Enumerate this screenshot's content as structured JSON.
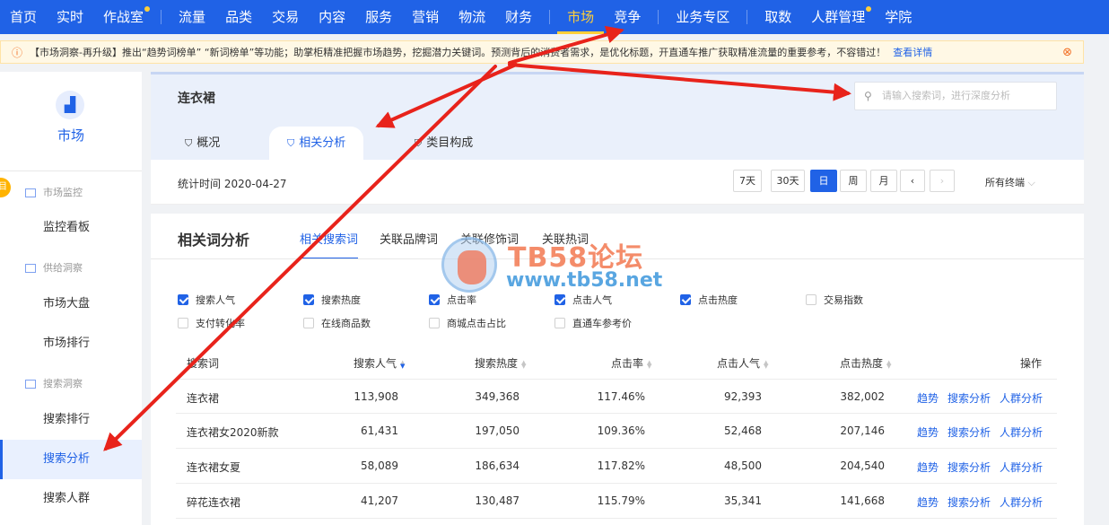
{
  "nav": {
    "items": [
      {
        "label": "首页",
        "active": false,
        "dot": false
      },
      {
        "label": "实时",
        "active": false,
        "dot": false
      },
      {
        "label": "作战室",
        "active": false,
        "dot": true
      },
      {
        "label": "流量",
        "active": false,
        "dot": false
      },
      {
        "label": "品类",
        "active": false,
        "dot": false
      },
      {
        "label": "交易",
        "active": false,
        "dot": false
      },
      {
        "label": "内容",
        "active": false,
        "dot": false
      },
      {
        "label": "服务",
        "active": false,
        "dot": false
      },
      {
        "label": "营销",
        "active": false,
        "dot": false
      },
      {
        "label": "物流",
        "active": false,
        "dot": false
      },
      {
        "label": "财务",
        "active": false,
        "dot": false
      },
      {
        "label": "市场",
        "active": true,
        "dot": false
      },
      {
        "label": "竞争",
        "active": false,
        "dot": false
      },
      {
        "label": "业务专区",
        "active": false,
        "dot": false
      },
      {
        "label": "取数",
        "active": false,
        "dot": false
      },
      {
        "label": "人群管理",
        "active": false,
        "dot": true
      },
      {
        "label": "学院",
        "active": false,
        "dot": false
      }
    ]
  },
  "notice": {
    "text": "【市场洞察-再升级】推出“趋势词榜单” “新词榜单”等功能；助掌柜精准把握市场趋势，挖掘潜力关键词。预测背后的消费者需求，是优化标题，开直通车推广获取精准流量的重要参考，不容错过！",
    "link": "查看详情"
  },
  "sidebar": {
    "title": "市场",
    "groups": [
      "市场监控",
      "供给洞察",
      "搜索洞察"
    ],
    "items": [
      "监控看板",
      "市场大盘",
      "市场排行",
      "搜索排行",
      "搜索分析",
      "搜索人群"
    ]
  },
  "header": {
    "title": "连衣裙",
    "search_placeholder": "请输入搜索词，进行深度分析",
    "tabs": [
      "概况",
      "相关分析",
      "类目构成"
    ]
  },
  "date_bar": {
    "label": "统计时间 2020-04-27",
    "buttons": [
      "7天",
      "30天",
      "日",
      "周",
      "月"
    ],
    "terminal": "所有终端"
  },
  "main": {
    "title": "相关词分析",
    "tabs": [
      "相关搜索词",
      "关联品牌词",
      "关联修饰词",
      "关联热词"
    ],
    "checks": [
      {
        "label": "搜索人气",
        "checked": true
      },
      {
        "label": "搜索热度",
        "checked": true
      },
      {
        "label": "点击率",
        "checked": true
      },
      {
        "label": "点击人气",
        "checked": true
      },
      {
        "label": "点击热度",
        "checked": true
      },
      {
        "label": "交易指数",
        "checked": false
      },
      {
        "label": "支付转化率",
        "checked": false
      },
      {
        "label": "在线商品数",
        "checked": false
      },
      {
        "label": "商城点击占比",
        "checked": false
      },
      {
        "label": "直通车参考价",
        "checked": false
      }
    ],
    "headers": [
      "搜索词",
      "搜索人气",
      "搜索热度",
      "点击率",
      "点击人气",
      "点击热度",
      "操作"
    ],
    "ops": [
      "趋势",
      "搜索分析",
      "人群分析"
    ],
    "rows": [
      [
        "连衣裙",
        "113,908",
        "349,368",
        "117.46%",
        "92,393",
        "382,002"
      ],
      [
        "连衣裙女2020新款",
        "61,431",
        "197,050",
        "109.36%",
        "52,468",
        "207,146"
      ],
      [
        "连衣裙女夏",
        "58,089",
        "186,634",
        "117.82%",
        "48,500",
        "204,540"
      ],
      [
        "碎花连衣裙",
        "41,207",
        "130,487",
        "115.79%",
        "35,341",
        "141,668"
      ]
    ]
  },
  "watermark": {
    "line1": "TB58论坛",
    "line2": "www.tb58.net"
  },
  "colors": {
    "brand": "#2062e6",
    "active_nav": "#ffcf3a",
    "arrow": "#e8231b"
  }
}
